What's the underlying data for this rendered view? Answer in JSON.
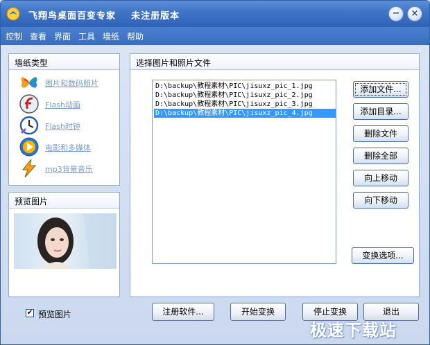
{
  "window": {
    "title": "飞翔鸟桌面百变专家    未注册版本"
  },
  "titlebar_buttons": {
    "minimize": "−",
    "close": "×"
  },
  "menu": [
    "控制",
    "查看",
    "界面",
    "工具",
    "墙纸",
    "帮助"
  ],
  "wallpaper_types": {
    "title": "墙纸类型",
    "items": [
      {
        "label": "图片和数码照片",
        "icon": "butterfly-icon"
      },
      {
        "label": "Flash动画",
        "icon": "flash-icon"
      },
      {
        "label": "Flash时钟",
        "icon": "clock-icon"
      },
      {
        "label": "电影和多媒体",
        "icon": "media-player-icon"
      },
      {
        "label": "mp3背景音乐",
        "icon": "winamp-icon"
      }
    ]
  },
  "preview": {
    "title": "预览图片"
  },
  "files": {
    "title": "选择图片和照片文件",
    "items": [
      "D:\\backup\\教程素材\\PIC\\jisuxz_pic_1.jpg",
      "D:\\backup\\教程素材\\PIC\\jisuxz_pic_2.jpg",
      "D:\\backup\\教程素材\\PIC\\jisuxz_pic_3.jpg",
      "D:\\backup\\教程素材\\PIC\\jisuxz_pic_4.jpg"
    ],
    "selected_index": 3
  },
  "actions": {
    "add_file": "添加文件...",
    "add_dir": "添加目录...",
    "delete_file": "删除文件",
    "delete_all": "删除全部",
    "move_up": "向上移动",
    "move_down": "向下移动",
    "transition_options": "变换选项..."
  },
  "bottom": {
    "preview_checkbox": "预览图片",
    "preview_checked": true,
    "register": "注册软件...",
    "start": "开始变换",
    "stop": "停止变换",
    "exit": "退出"
  },
  "watermark": "极速下载站",
  "colors": {
    "title_bar": "#3f74c6",
    "menu_bar": "#3a6dbd",
    "selection": "#3399ff",
    "link": "#7a9bd0"
  }
}
